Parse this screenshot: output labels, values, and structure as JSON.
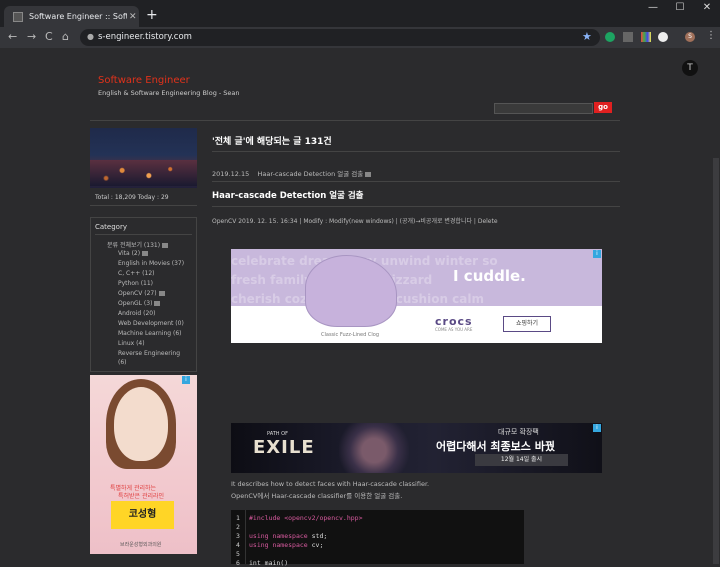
{
  "browser": {
    "tab_title": "Software Engineer :: Software E",
    "tab_close": "✕",
    "new_tab": "+",
    "url": "s-engineer.tistory.com",
    "win_min": "—",
    "win_max": "☐",
    "win_close": "✕",
    "back": "←",
    "forward": "→",
    "reload": "C",
    "home": "⌂",
    "star": "★",
    "menu": "⋮",
    "avatar": "S"
  },
  "site": {
    "title": "Software Engineer",
    "subtitle": "English & Software Engineering Blog - Sean",
    "search_button": "go",
    "top_button": "T"
  },
  "sidebar": {
    "counter": "Total : 18,209  Today : 29",
    "category_title": "Category",
    "categories": [
      {
        "label": "분류 전체보기 (131)",
        "badge": true
      },
      {
        "label": "Vita (2)",
        "badge": true
      },
      {
        "label": "English in Movies (37)",
        "badge": false
      },
      {
        "label": "C, C++ (12)",
        "badge": false
      },
      {
        "label": "Python (11)",
        "badge": false
      },
      {
        "label": "OpenCV (27)",
        "badge": true
      },
      {
        "label": "OpenGL (3)",
        "badge": true
      },
      {
        "label": "Android (20)",
        "badge": false
      },
      {
        "label": "Web Development (0)",
        "badge": false
      },
      {
        "label": "Machine Learning (6)",
        "badge": false
      },
      {
        "label": "Linux (4)",
        "badge": false
      },
      {
        "label": "Reverse Engineering",
        "badge": false
      },
      {
        "label": "(6)",
        "badge": false
      }
    ],
    "ad": {
      "headline1": "특별하게 관리하는",
      "headline2": "특허받은 관리라인",
      "button": "코성형",
      "brand": "브라운성형외과의원",
      "ad_mark": "i"
    }
  },
  "main": {
    "heading": "'전체 글'에 해당되는 글 131건",
    "post_meta_date": "2019.12.15",
    "post_meta_title": "Haar-cascade Detection 얼굴 검출",
    "post_title": "Haar-cascade Detection 얼굴 검출",
    "post_info": "OpenCV  2019. 12. 15. 16:34 | Modify : Modify(new windows) | (공개)→비공개로 변경합니다 | Delete",
    "description_en": "It describes how to detect faces with Haar-cascade classifier.",
    "description_ko": "OpenCV에서 Haar-cascade classifier를 이용한 얼굴 검출."
  },
  "crocs_ad": {
    "bg_words": [
      "celebrate dream  cozy unwind winter so",
      "fresh family  embrace   blizzard",
      "cherish cozy  appreciate cushion calm"
    ],
    "tagline": "I cuddle.",
    "caption": "Classic Fuzz-Lined Clog",
    "logo": "crocs",
    "logo_tag": "COME AS YOU ARE",
    "cta": "쇼핑하기",
    "ad_mark": "i"
  },
  "poe_ad": {
    "logo_small": "PATH OF",
    "logo_big": "EXILE",
    "line1": "대규모 확장팩",
    "line2": "어렵다해서 최종보스 바꿨",
    "line3": "12월 14일 출시",
    "ad_mark": "i"
  },
  "code": {
    "line_numbers": [
      "1",
      "2",
      "3",
      "4",
      "5",
      "6"
    ],
    "line1_kw": "#include",
    "line1_str": "<opencv2/opencv.hpp>",
    "line3_kw": "using namespace",
    "line3_rest": "std;",
    "line4_kw": "using namespace",
    "line4_rest": "cv;",
    "line6": "int main()"
  }
}
